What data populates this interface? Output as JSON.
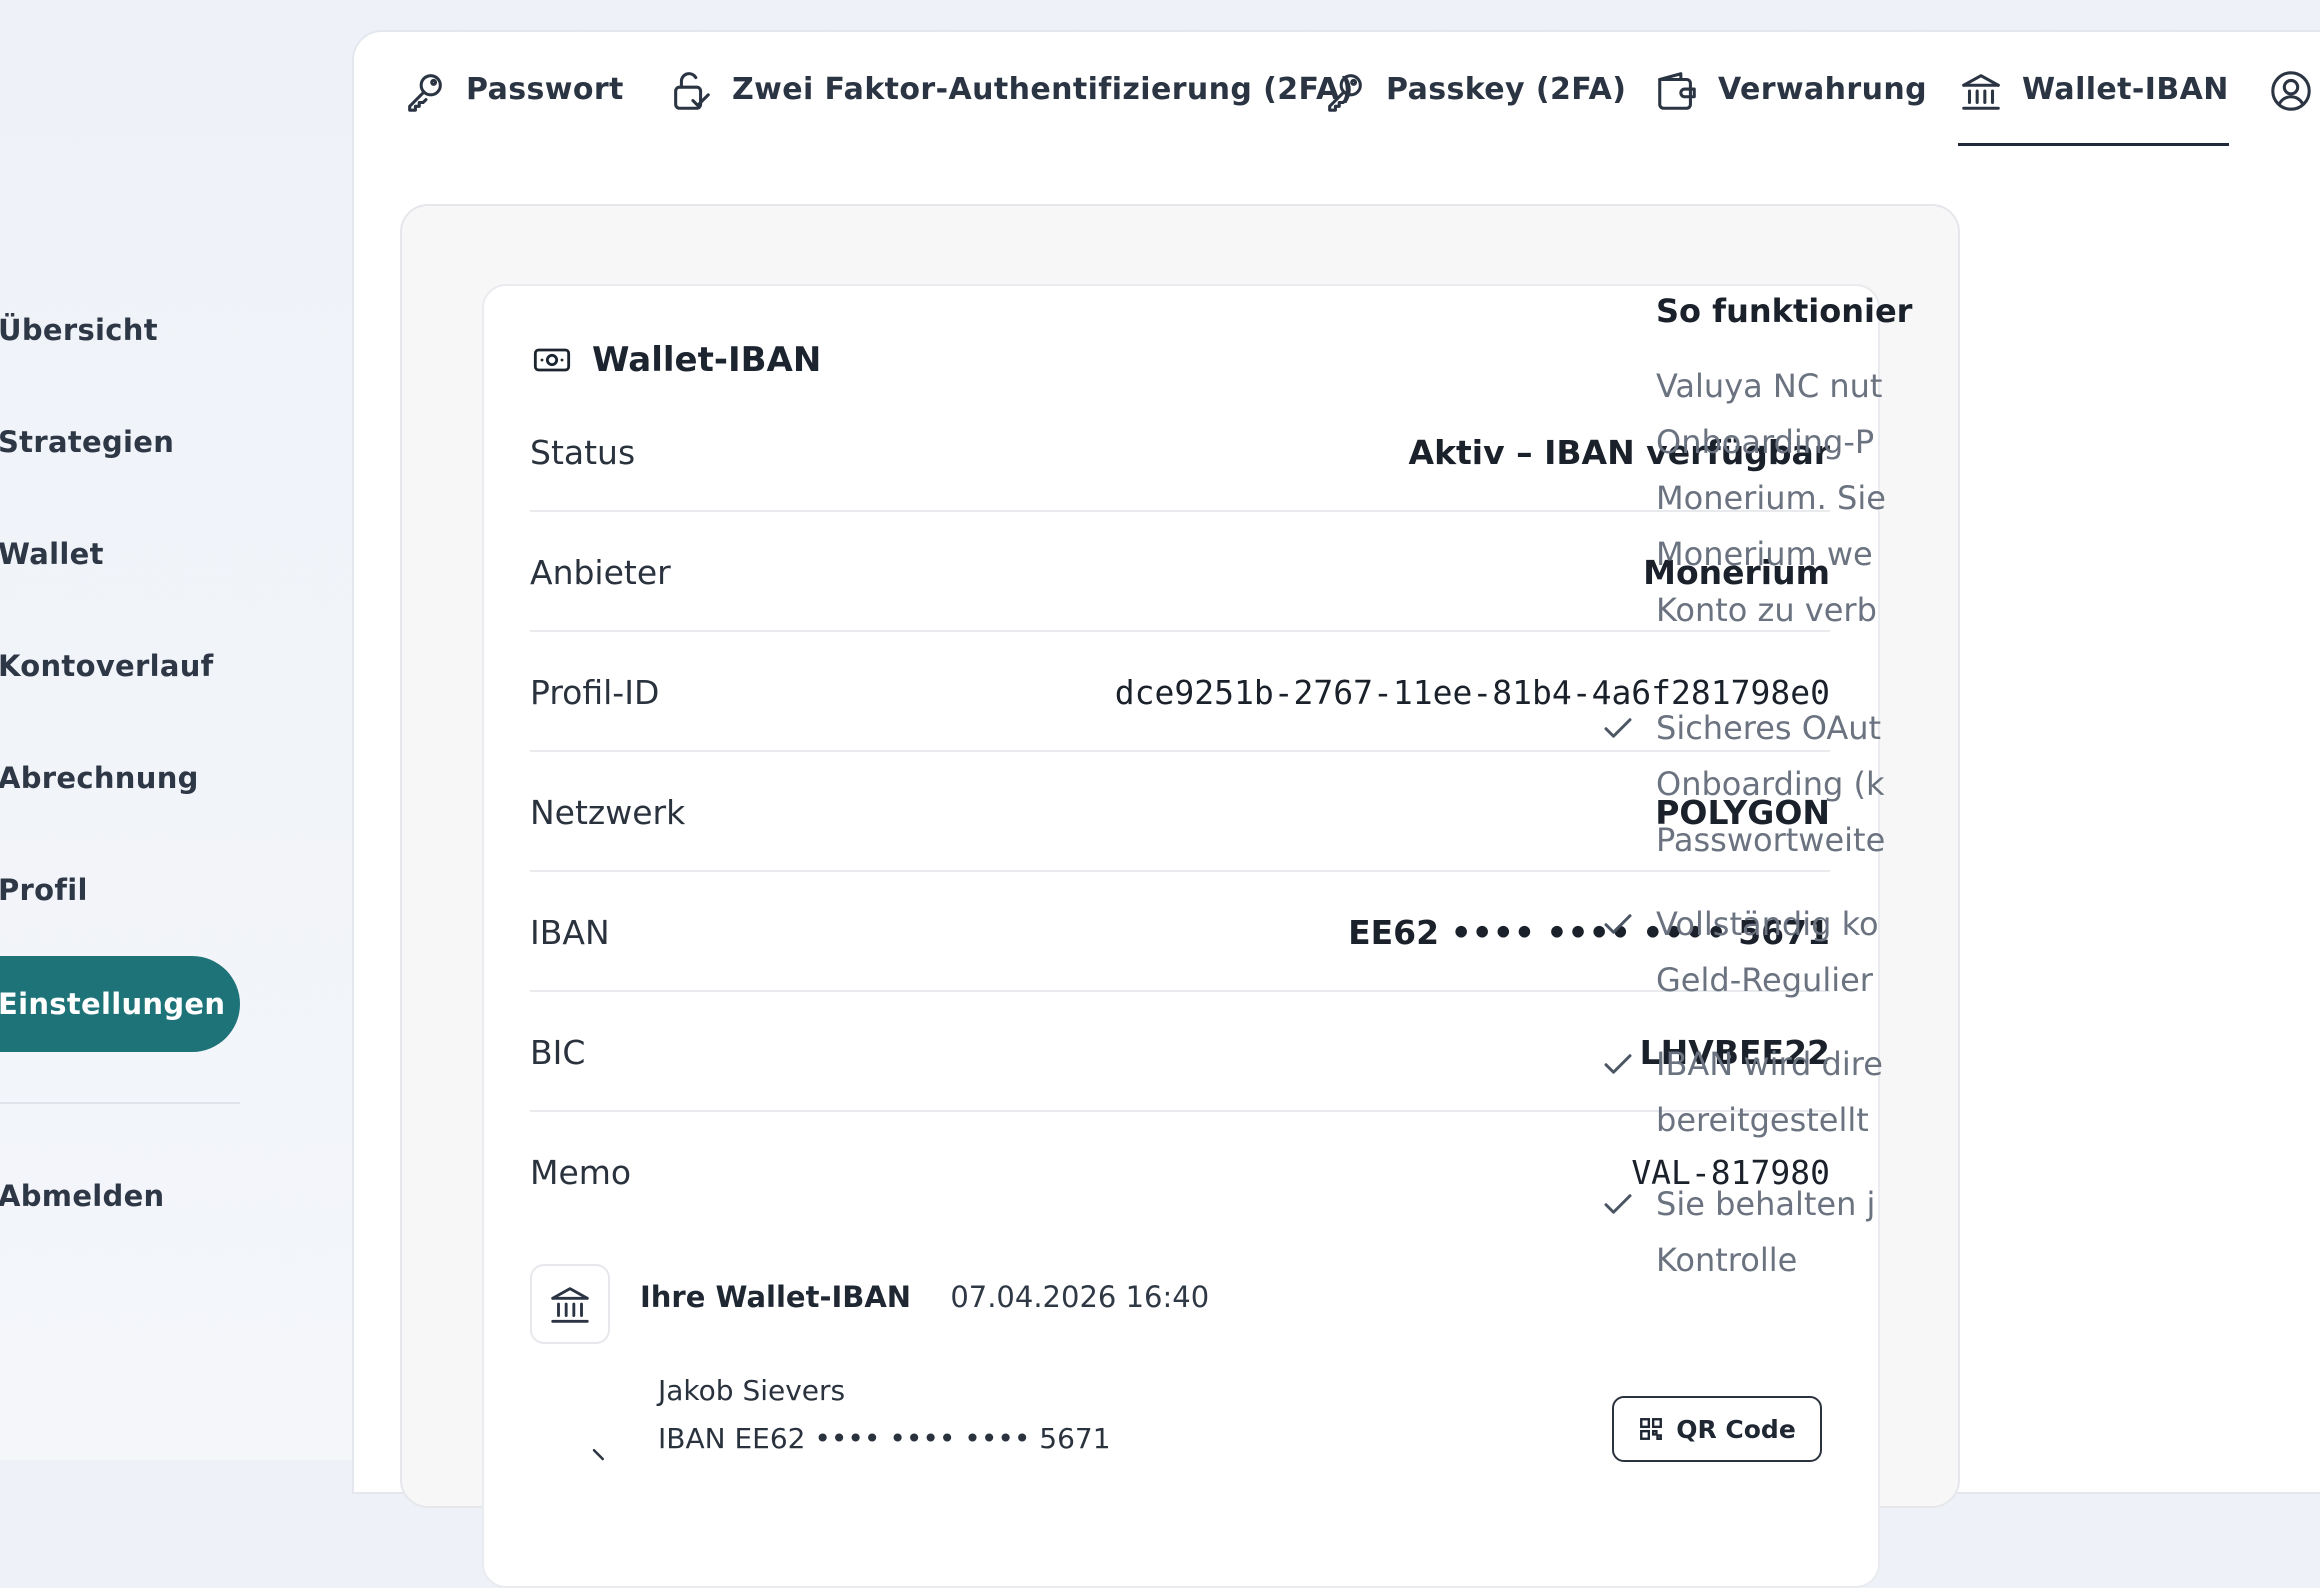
{
  "sidebar": {
    "items": [
      {
        "label": "Übersicht"
      },
      {
        "label": "Strategien"
      },
      {
        "label": "Wallet"
      },
      {
        "label": "Kontoverlauf"
      },
      {
        "label": "Abrechnung"
      },
      {
        "label": "Profil"
      },
      {
        "label": "Einstellungen",
        "active": true
      }
    ],
    "logout": "Abmelden"
  },
  "tabs": [
    {
      "label": "Passwort",
      "icon": "key-icon"
    },
    {
      "label": "Zwei Faktor-Authentifizierung (2FA)",
      "icon": "lock-check-icon"
    },
    {
      "label": "Passkey (2FA)",
      "icon": "key-icon"
    },
    {
      "label": "Verwahrung",
      "icon": "wallet-icon"
    },
    {
      "label": "Wallet-IBAN",
      "icon": "bank-icon",
      "active": true
    },
    {
      "label": "",
      "icon": "user-circle-icon"
    }
  ],
  "card": {
    "title": "Wallet-IBAN",
    "rows": [
      {
        "label": "Status",
        "value": "Aktiv – IBAN verfügbar"
      },
      {
        "label": "Anbieter",
        "value": "Monerium"
      },
      {
        "label": "Profil-ID",
        "value": "dce9251b-2767-11ee-81b4-4a6f281798e0"
      },
      {
        "label": "Netzwerk",
        "value": "POLYGON"
      },
      {
        "label": "IBAN",
        "value": "EE62 •••• •••• •••• 5671"
      },
      {
        "label": "BIC",
        "value": "LHVBEE22"
      },
      {
        "label": "Memo",
        "value": "VAL-817980"
      }
    ],
    "iban_block": {
      "title": "Ihre Wallet-IBAN",
      "date": "07.04.2026 16:40",
      "name": "Jakob Sievers",
      "iban_line": "IBAN EE62 •••• •••• •••• 5671",
      "qr_label": "QR Code"
    }
  },
  "info": {
    "title": "So funktionier",
    "text_lines": [
      "Valuya NC nut",
      "Onboarding-P",
      "Monerium. Sie",
      "Monerium we",
      "Konto zu verb"
    ],
    "bullets": [
      [
        "Sicheres OAut",
        "Onboarding (k",
        "Passwortweite"
      ],
      [
        "Vollständig ko",
        "Geld-Regulier"
      ],
      [
        "IBAN wird dire",
        "bereitgestellt"
      ],
      [
        "Sie behalten j",
        "Kontrolle"
      ]
    ]
  }
}
